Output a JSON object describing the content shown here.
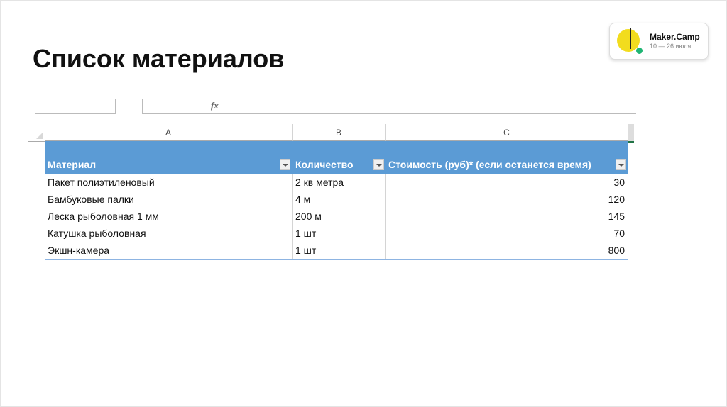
{
  "slide": {
    "title": "Список материалов"
  },
  "logo": {
    "name": "Maker.Camp",
    "dates": "10 — 26 июля"
  },
  "formula_bar": {
    "fx_label": "fx"
  },
  "columns": [
    "A",
    "B",
    "C"
  ],
  "table": {
    "headers": [
      "Материал",
      "Количество",
      "Стоимость (руб)* (если останется время)"
    ],
    "rows": [
      [
        "Пакет полиэтиленовый",
        "2 кв метра",
        "30"
      ],
      [
        "Бамбуковые палки",
        "4 м",
        "120"
      ],
      [
        "Леска рыболовная 1 мм",
        "200 м",
        "145"
      ],
      [
        "Катушка рыболовная",
        "1 шт",
        "70"
      ],
      [
        "Экшн-камера",
        "1 шт",
        "800"
      ]
    ]
  },
  "colors": {
    "header_blue": "#5b9bd5",
    "row_border": "#8db4e2"
  }
}
